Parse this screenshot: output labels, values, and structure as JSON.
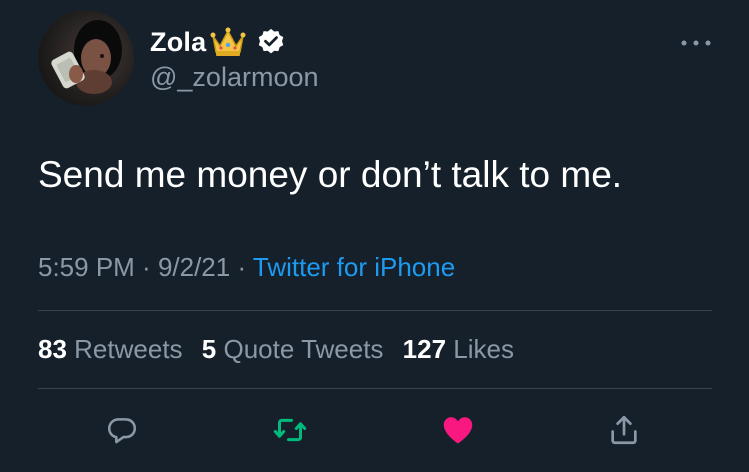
{
  "tweet": {
    "author": {
      "display_name": "Zola",
      "handle": "@_zolarmoon",
      "name_badge": "crown-icon",
      "verified": true
    },
    "text": "Send me money or don’t talk to me.",
    "time": "5:59 PM",
    "separator": " · ",
    "date": "9/2/21",
    "source": "Twitter for iPhone",
    "stats": {
      "retweets_count": "83",
      "retweets_label": "Retweets",
      "quote_tweets_count": "5",
      "quote_tweets_label": "Quote Tweets",
      "likes_count": "127",
      "likes_label": "Likes"
    },
    "actions": [
      "reply-icon",
      "retweet-icon",
      "like-icon",
      "share-icon"
    ]
  },
  "colors": {
    "background": "#15202b",
    "text_primary": "#ffffff",
    "text_secondary": "#8b98a5",
    "link": "#1d9bf0",
    "retweet_green": "#00ba7c",
    "like_pink": "#f91880",
    "divider": "#38444d"
  }
}
